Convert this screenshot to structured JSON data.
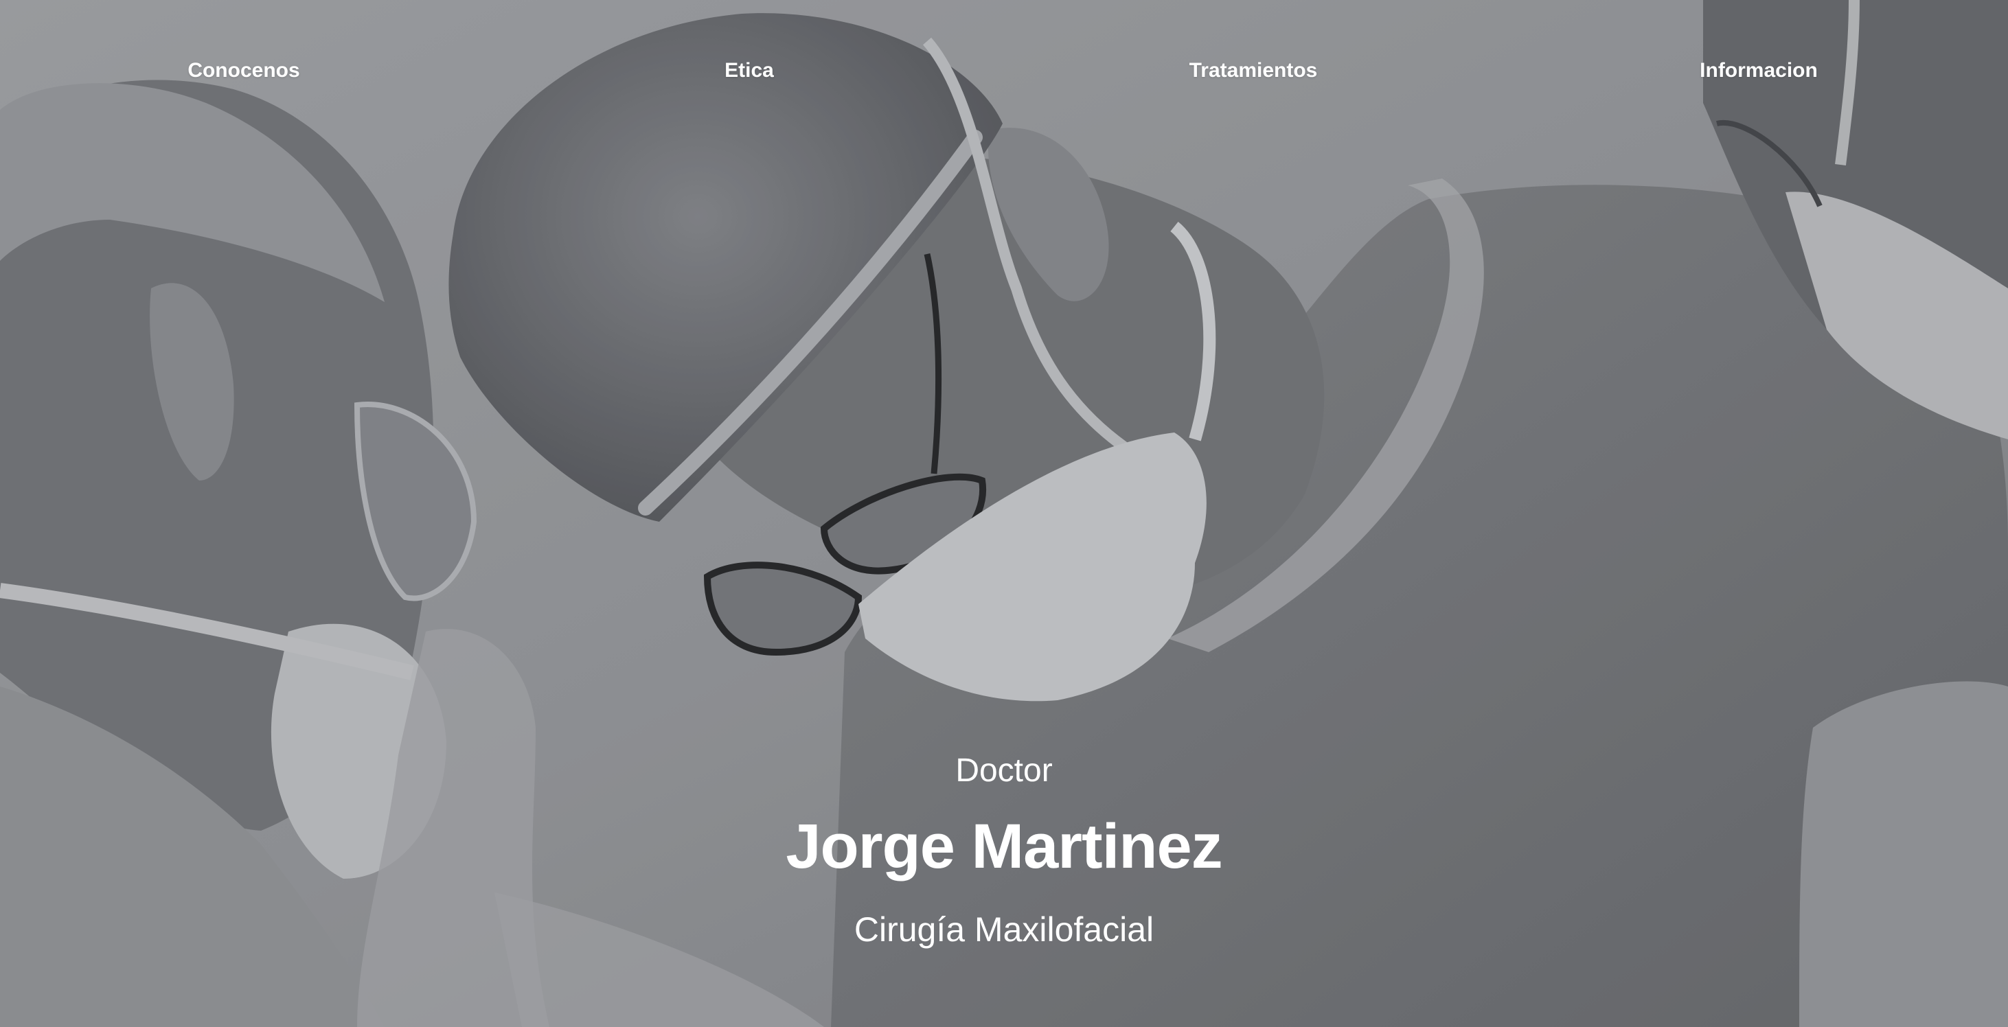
{
  "nav": {
    "items": [
      {
        "label": "Conocenos"
      },
      {
        "label": "Etica"
      },
      {
        "label": "Tratamientos"
      },
      {
        "label": "Informacion"
      }
    ]
  },
  "hero": {
    "title_prefix": "Doctor",
    "name": "Jorge Martinez",
    "specialty": "Cirugía Maxilofacial",
    "background_photo": "grayscale surgeons in operating room wearing caps, masks and glasses",
    "overlay_color": "#8f9094",
    "text_color": "#ffffff"
  }
}
